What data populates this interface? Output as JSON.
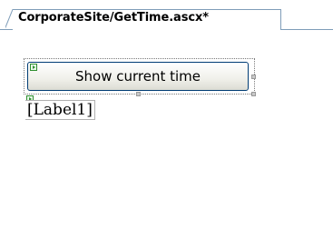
{
  "document_tab": {
    "label": "CorporateSite/GetTime.ascx*"
  },
  "design_surface": {
    "button": {
      "label": "Show current time"
    },
    "label_control": {
      "text": "[Label1]"
    }
  },
  "icons": {
    "smart_tag": "smart-tag-glyph",
    "selection_handle": "resize-handle"
  },
  "colors": {
    "tab_border": "#7f9db9",
    "glyph": "#2f8f2f",
    "button_border": "#003c74"
  }
}
